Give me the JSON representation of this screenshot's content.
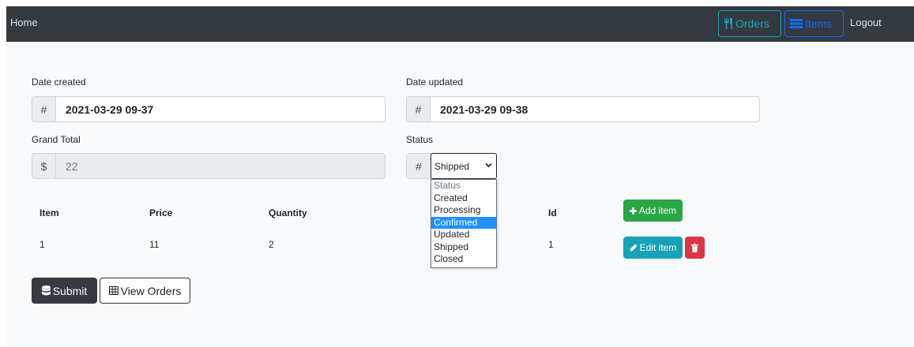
{
  "nav": {
    "brand": "Home",
    "orders_label": "Orders",
    "items_label": "Items",
    "logout_label": "Logout"
  },
  "form": {
    "date_created": {
      "label": "Date created",
      "prefix": "#",
      "value": "2021-03-29 09-37"
    },
    "date_updated": {
      "label": "Date updated",
      "prefix": "#",
      "value": "2021-03-29 09-38"
    },
    "grand_total": {
      "label": "Grand Total",
      "prefix": "$",
      "value": "22"
    },
    "status": {
      "label": "Status",
      "prefix": "#",
      "selected": "Shipped",
      "options": [
        "Status",
        "Created",
        "Processing",
        "Confirmed",
        "Updated",
        "Shipped",
        "Closed"
      ],
      "highlighted": "Confirmed"
    }
  },
  "table": {
    "headers": [
      "Item",
      "Price",
      "Quantity",
      "Id"
    ],
    "rows": [
      {
        "item": "1",
        "price": "11",
        "quantity": "2",
        "id": "1"
      }
    ],
    "add_label": "Add item",
    "edit_label": "Edit item"
  },
  "actions": {
    "submit_label": "Submit",
    "view_orders_label": "View Orders"
  },
  "colors": {
    "navbar": "#343a40",
    "info": "#17a2b8",
    "primary": "#0d6efd",
    "success": "#28a745",
    "danger": "#dc3545",
    "highlight": "#1e90ff"
  }
}
